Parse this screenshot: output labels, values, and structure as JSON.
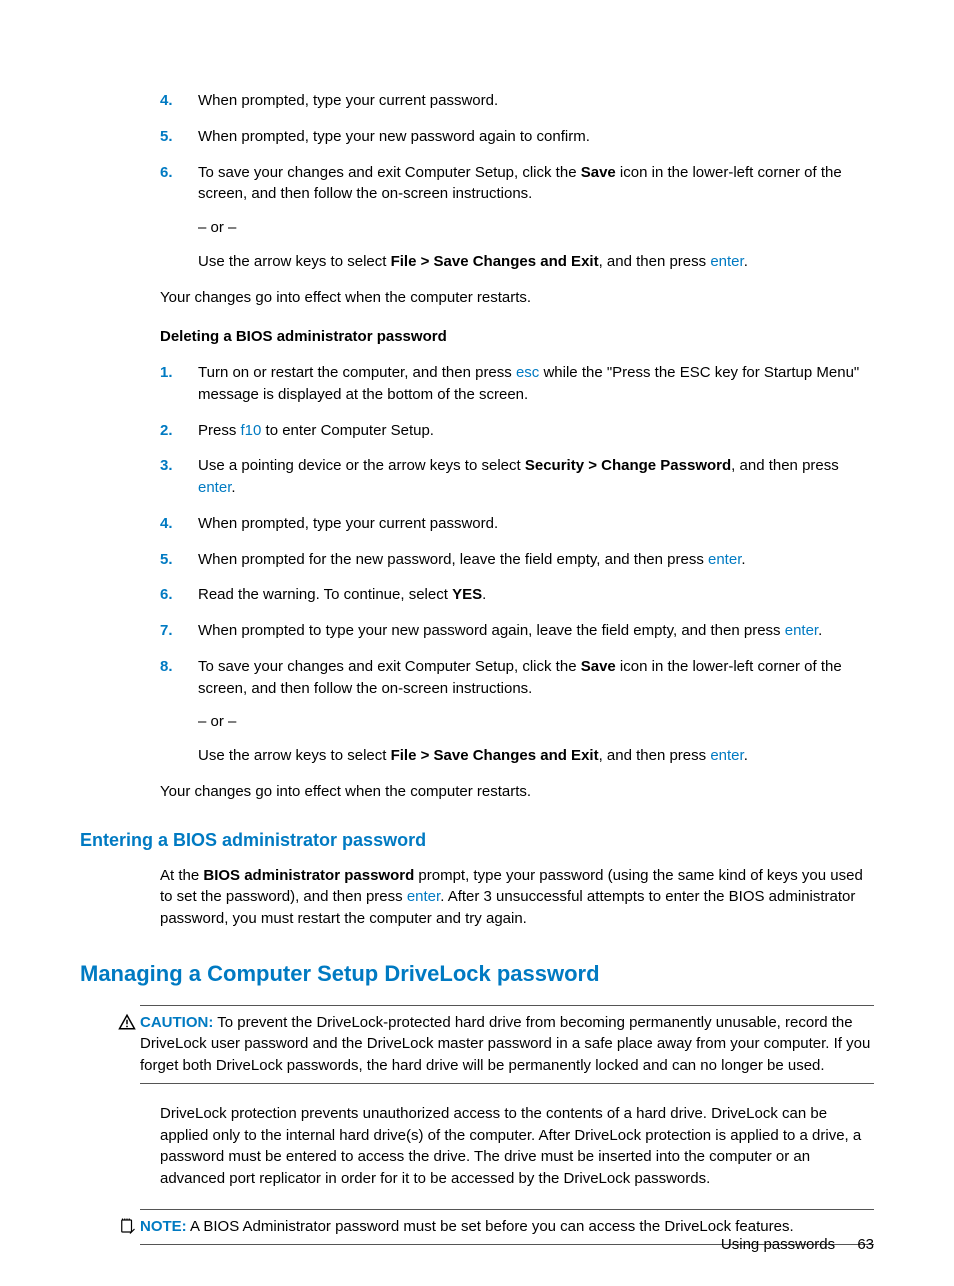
{
  "list1": {
    "i4": {
      "n": "4.",
      "t": "When prompted, type your current password."
    },
    "i5": {
      "n": "5.",
      "t": "When prompted, type your new password again to confirm."
    },
    "i6": {
      "n": "6.",
      "a": "To save your changes and exit Computer Setup, click the ",
      "b": "Save",
      "c": " icon in the lower-left corner of the screen, and then follow the on-screen instructions.",
      "or": "– or –",
      "d": "Use the arrow keys to select ",
      "e": "File > Save Changes and Exit",
      "f": ", and then press ",
      "enter": "enter",
      "g": "."
    }
  },
  "effect1": "Your changes go into effect when the computer restarts.",
  "delHead": "Deleting a BIOS administrator password",
  "list2": {
    "i1": {
      "n": "1.",
      "a": "Turn on or restart the computer, and then press ",
      "esc": "esc",
      "b": " while the \"Press the ESC key for Startup Menu\" message is displayed at the bottom of the screen."
    },
    "i2": {
      "n": "2.",
      "a": "Press ",
      "f10": "f10",
      "b": " to enter Computer Setup."
    },
    "i3": {
      "n": "3.",
      "a": "Use a pointing device or the arrow keys to select ",
      "b": "Security > Change Password",
      "c": ", and then press ",
      "enter": "enter",
      "d": "."
    },
    "i4": {
      "n": "4.",
      "t": "When prompted, type your current password."
    },
    "i5": {
      "n": "5.",
      "a": "When prompted for the new password, leave the field empty, and then press ",
      "enter": "enter",
      "b": "."
    },
    "i6": {
      "n": "6.",
      "a": "Read the warning. To continue, select ",
      "yes": "YES",
      "b": "."
    },
    "i7": {
      "n": "7.",
      "a": "When prompted to type your new password again, leave the field empty, and then press ",
      "enter": "enter",
      "b": "."
    },
    "i8": {
      "n": "8.",
      "a": "To save your changes and exit Computer Setup, click the ",
      "b": "Save",
      "c": " icon in the lower-left corner of the screen, and then follow the on-screen instructions.",
      "or": "– or –",
      "d": "Use the arrow keys to select ",
      "e": "File > Save Changes and Exit",
      "f": ", and then press ",
      "enter": "enter",
      "g": "."
    }
  },
  "effect2": "Your changes go into effect when the computer restarts.",
  "h3": "Entering a BIOS administrator password",
  "para_enter": {
    "a": "At the ",
    "b": "BIOS administrator password",
    "c": " prompt, type your password (using the same kind of keys you used to set the password), and then press ",
    "enter": "enter",
    "d": ". After 3 unsuccessful attempts to enter the BIOS administrator password, you must restart the computer and try again."
  },
  "h2": "Managing a Computer Setup DriveLock password",
  "caution": {
    "label": "CAUTION:",
    "text": "   To prevent the DriveLock-protected hard drive from becoming permanently unusable, record the DriveLock user password and the DriveLock master password in a safe place away from your computer. If you forget both DriveLock passwords, the hard drive will be permanently locked and can no longer be used."
  },
  "dl_para": "DriveLock protection prevents unauthorized access to the contents of a hard drive. DriveLock can be applied only to the internal hard drive(s) of the computer. After DriveLock protection is applied to a drive, a password must be entered to access the drive. The drive must be inserted into the computer or an advanced port replicator in order for it to be accessed by the DriveLock passwords.",
  "note": {
    "label": "NOTE:",
    "text": "   A BIOS Administrator password must be set before you can access the DriveLock features."
  },
  "footer": {
    "section": "Using passwords",
    "page": "63"
  }
}
